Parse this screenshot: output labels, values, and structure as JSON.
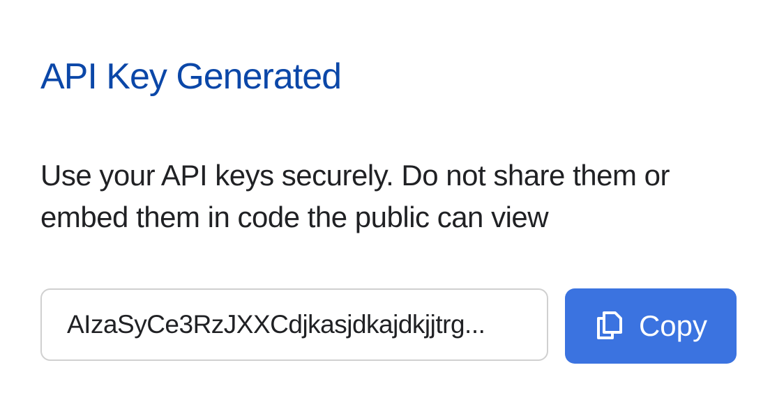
{
  "dialog": {
    "title": "API Key Generated",
    "description": "Use your API keys securely. Do not share them or embed them in code the public can view",
    "api_key_display": "AIzaSyCe3RzJXXCdjkasjdkajdkjjtrg...",
    "copy_button": {
      "label": "Copy",
      "icon": "copy-icon"
    },
    "colors": {
      "title": "#0b47a8",
      "button": "#3b73e0"
    }
  }
}
